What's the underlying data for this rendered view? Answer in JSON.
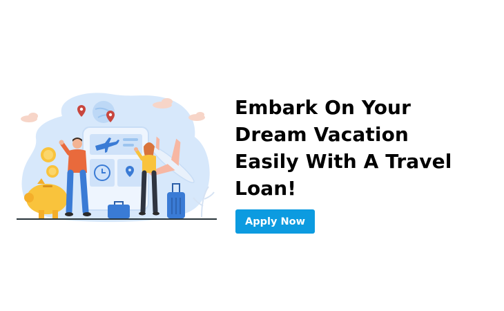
{
  "headline": {
    "line1": "Embark On Your",
    "line2": "Dream Vacation",
    "line3": "Easily With A Travel",
    "line4": "Loan!"
  },
  "cta": {
    "label": "Apply Now"
  },
  "colors": {
    "button_bg": "#0C9BE0",
    "button_text": "#FFFFFF",
    "headline_text": "#000000",
    "blob_bg": "#D7E8FB",
    "accent_yellow": "#F9C33C",
    "accent_orange": "#E96A3C",
    "accent_blue": "#3A7BD5",
    "cloud_peach": "#F7D5C8"
  },
  "illustration": {
    "icons": [
      "map-pin-icon",
      "airplane-icon",
      "clock-icon",
      "globe-icon",
      "piggy-bank-icon",
      "coin-icon",
      "suitcase-icon",
      "luggage-icon",
      "cloud-icon"
    ],
    "people": [
      "man-waving",
      "woman-pointing"
    ]
  }
}
